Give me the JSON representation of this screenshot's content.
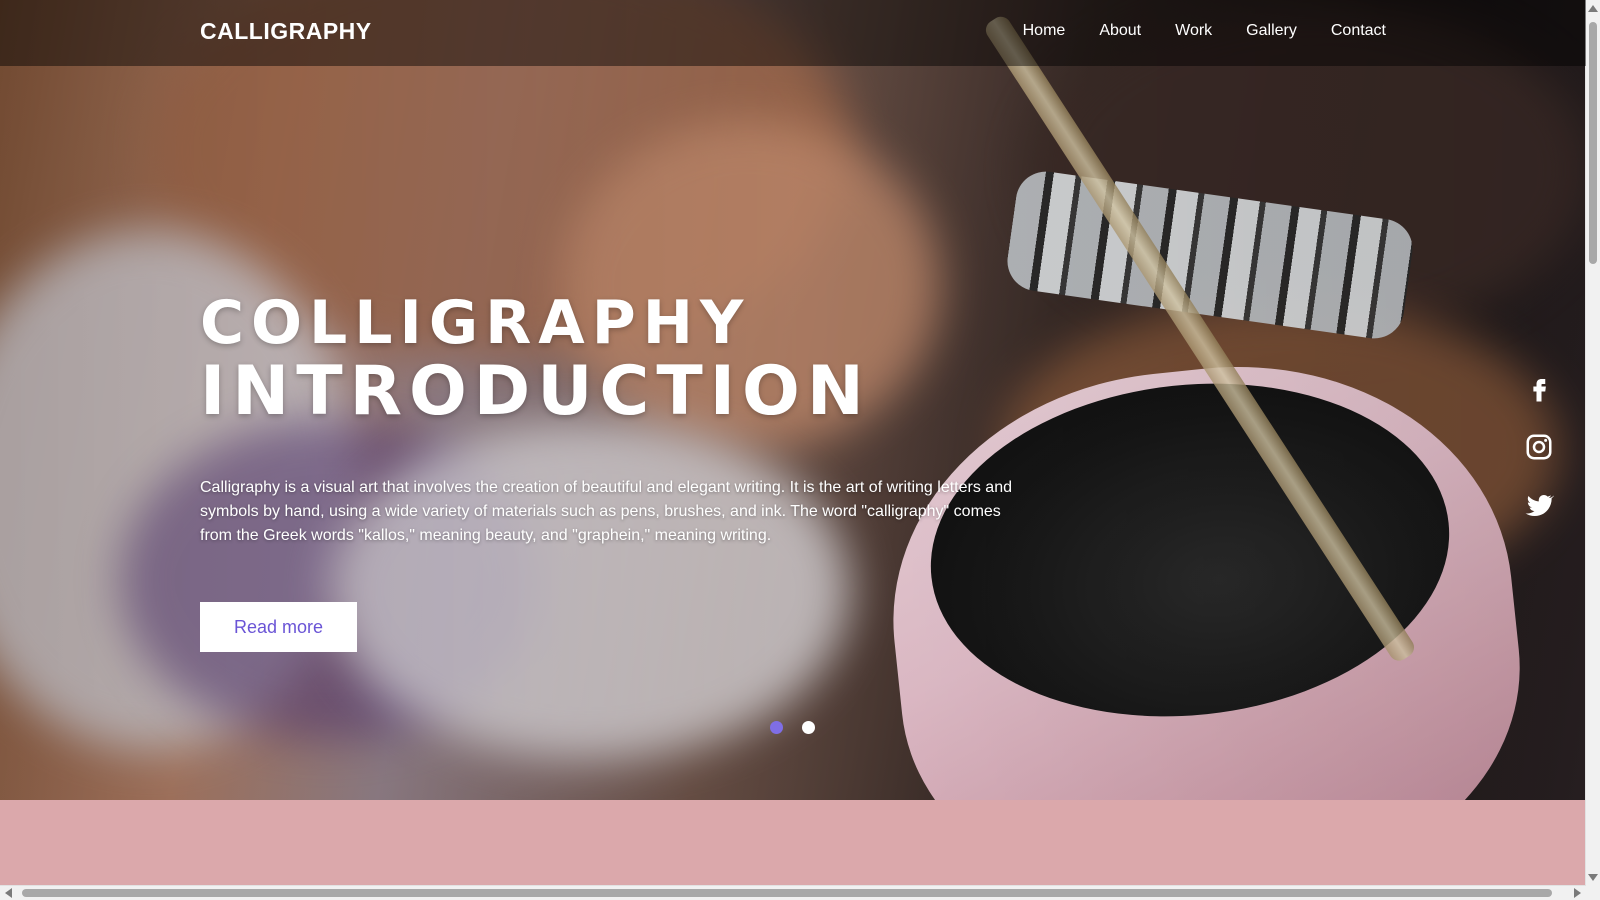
{
  "navbar": {
    "brand": "CALLIGRAPHY",
    "links": [
      "Home",
      "About",
      "Work",
      "Gallery",
      "Contact"
    ]
  },
  "hero": {
    "title_line1": "COLLIGRAPHY",
    "title_line2": "INTRODUCTION",
    "description": "Calligraphy is a visual art that involves the creation of beautiful and elegant writing. It is the art of writing letters and symbols by hand, using a wide variety of materials such as pens, brushes, and ink. The word \"calligraphy\" comes from the Greek words \"kallos,\" meaning beauty, and \"graphein,\" meaning writing.",
    "button_label": "Read more",
    "carousel": {
      "slide_count": 2,
      "active_index": 0
    }
  },
  "social": {
    "icons": [
      "facebook-icon",
      "instagram-icon",
      "twitter-icon"
    ]
  },
  "colors": {
    "accent": "#7f6ee6",
    "button_text": "#6a54d6",
    "section_pink": "#dba8ab",
    "navbar_bg": "rgba(0,0,0,0.45)"
  }
}
